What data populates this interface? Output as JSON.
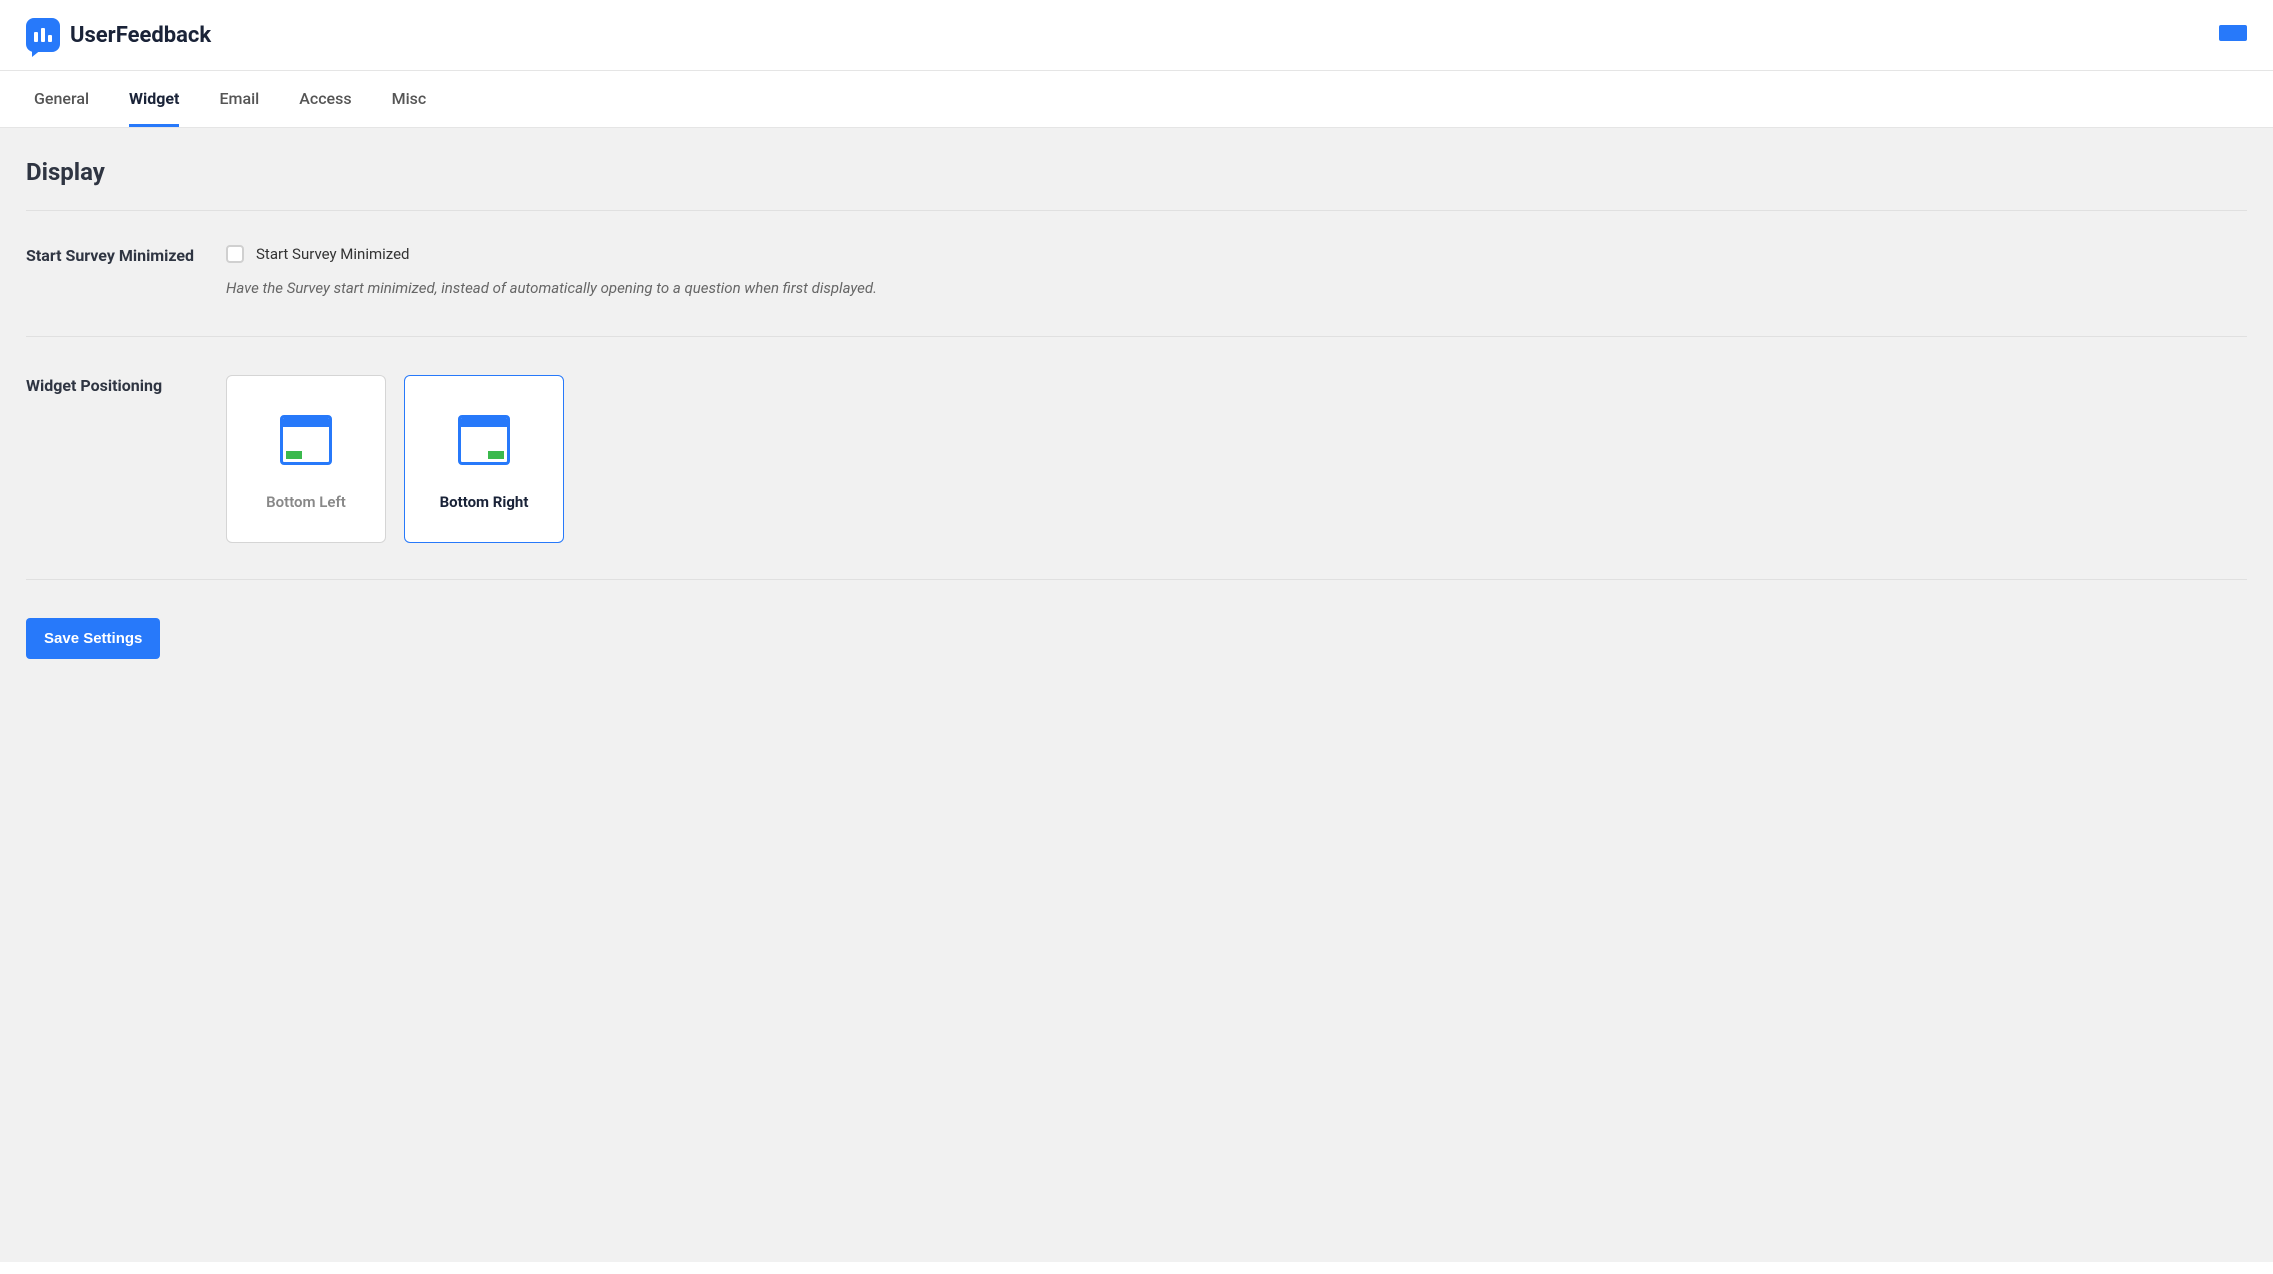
{
  "header": {
    "brand": "UserFeedback"
  },
  "tabs": [
    {
      "label": "General",
      "active": false
    },
    {
      "label": "Widget",
      "active": true
    },
    {
      "label": "Email",
      "active": false
    },
    {
      "label": "Access",
      "active": false
    },
    {
      "label": "Misc",
      "active": false
    }
  ],
  "section": {
    "title": "Display"
  },
  "settings": {
    "start_minimized": {
      "label": "Start Survey Minimized",
      "checkbox_label": "Start Survey Minimized",
      "checked": false,
      "help": "Have the Survey start minimized, instead of automatically opening to a question when first displayed."
    },
    "positioning": {
      "label": "Widget Positioning",
      "options": [
        {
          "key": "bottom_left",
          "label": "Bottom Left",
          "selected": false,
          "side": "left"
        },
        {
          "key": "bottom_right",
          "label": "Bottom Right",
          "selected": true,
          "side": "right"
        }
      ]
    }
  },
  "actions": {
    "save_label": "Save Settings"
  }
}
